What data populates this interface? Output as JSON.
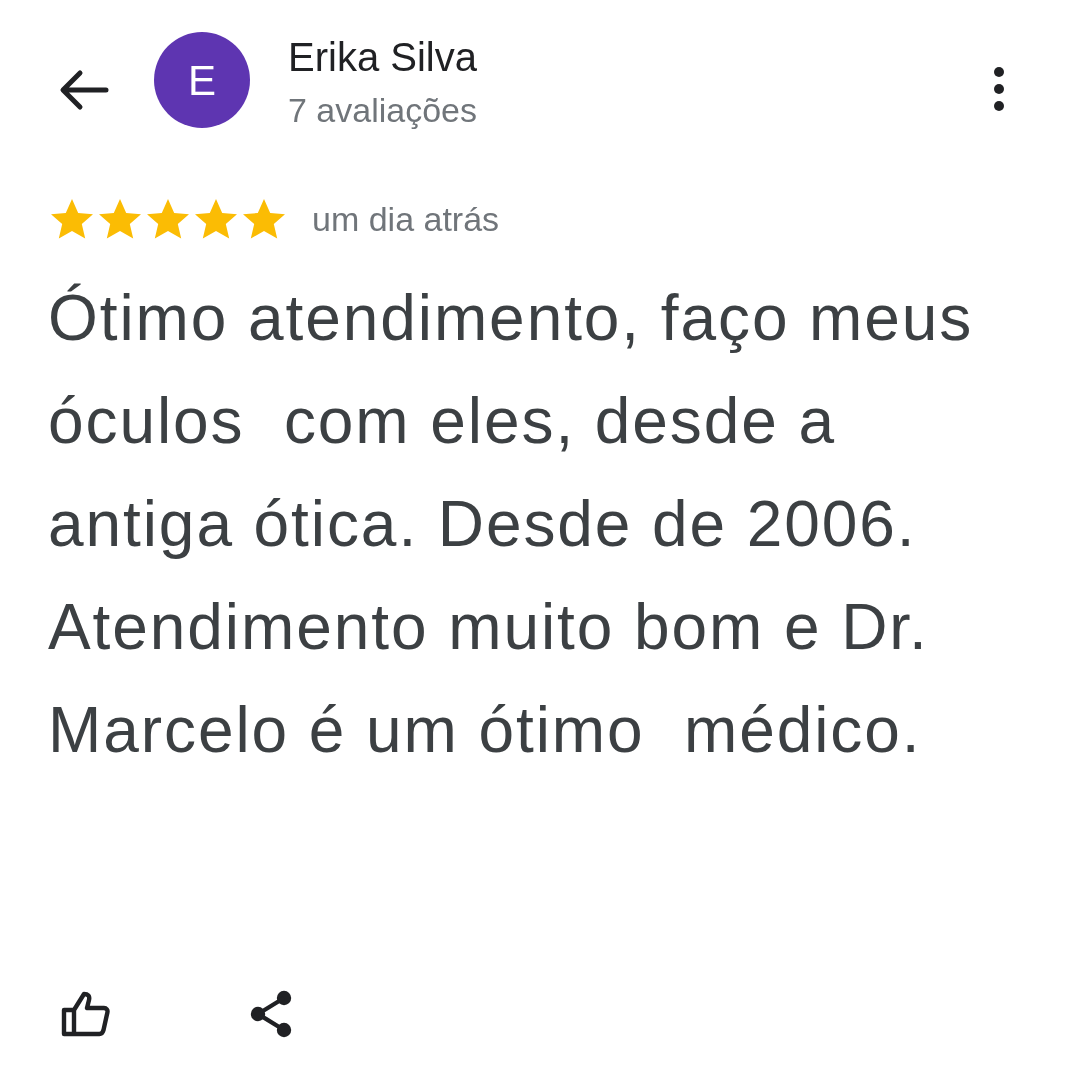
{
  "reviewer": {
    "initial": "E",
    "name": "Erika Silva",
    "review_count": "7 avaliações"
  },
  "review": {
    "stars": 5,
    "time": "um dia atrás",
    "text": "Ótimo atendimento, faço meus óculos  com eles, desde a antiga ótica. Desde de 2006. Atendimento muito bom e Dr. Marcelo é um ótimo  médico."
  }
}
